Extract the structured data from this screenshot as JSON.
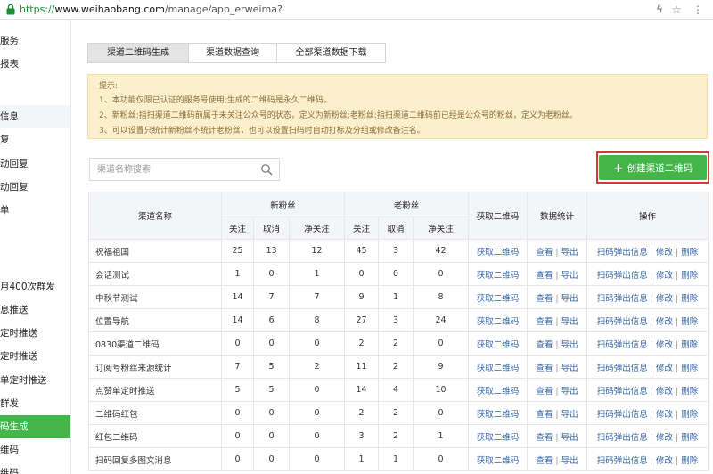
{
  "browser": {
    "url_scheme": "https://",
    "url_domain": "www.weihaobang.com",
    "url_path": "/manage/app_erweima?",
    "star_icon": "☆",
    "bolt_icon": "ϟ",
    "menu_icon": "⋮"
  },
  "sidebar": {
    "items": [
      {
        "label": "服务",
        "state": "normal"
      },
      {
        "label": "报表",
        "state": "normal"
      },
      {
        "label": "信息",
        "state": "grey"
      },
      {
        "label": "复",
        "state": "normal"
      },
      {
        "label": "动回复",
        "state": "normal"
      },
      {
        "label": "动回复",
        "state": "normal"
      },
      {
        "label": "单",
        "state": "normal"
      },
      {
        "label": "月400次群发",
        "state": "normal"
      },
      {
        "label": "息推送",
        "state": "normal"
      },
      {
        "label": "定时推送",
        "state": "normal"
      },
      {
        "label": "定时推送",
        "state": "normal"
      },
      {
        "label": "单定时推送",
        "state": "normal"
      },
      {
        "label": "群发",
        "state": "normal"
      },
      {
        "label": "码生成",
        "state": "active"
      },
      {
        "label": "维码",
        "state": "normal"
      },
      {
        "label": "维码",
        "state": "normal"
      }
    ]
  },
  "tabs": [
    {
      "label": "渠道二维码生成",
      "active": true
    },
    {
      "label": "渠道数据查询",
      "active": false
    },
    {
      "label": "全部渠道数据下载",
      "active": false
    }
  ],
  "notice": {
    "title": "提示:",
    "lines": [
      "1、本功能仅限已认证的服务号使用;生成的二维码是永久二维码。",
      "2、新粉丝:指扫渠道二维码前属于未关注公众号的状态，定义为新粉丝;老粉丝:指扫渠道二维码前已经是公众号的粉丝，定义为老粉丝。",
      "3、可以设置只统计新粉丝不统计老粉丝，也可以设置扫码时自动打标及分组或修改备注名。"
    ]
  },
  "search": {
    "placeholder": "渠道名称搜索",
    "value": ""
  },
  "create_button": {
    "label": "创建渠道二维码"
  },
  "table": {
    "headers": {
      "name": "渠道名称",
      "new_fans": "新粉丝",
      "old_fans": "老粉丝",
      "get_qr": "获取二维码",
      "stats": "数据统计",
      "ops": "操作",
      "follow": "关注",
      "cancel": "取消",
      "net": "净关注"
    },
    "actions": {
      "get_qr": "获取二维码",
      "view": "查看",
      "export": "导出",
      "popup": "扫码弹出信息",
      "edit": "修改",
      "delete": "删除",
      "sep": "|"
    },
    "rows": [
      {
        "name": "祝福祖国",
        "n_follow": "25",
        "n_cancel": "13",
        "n_net": "12",
        "o_follow": "45",
        "o_cancel": "3",
        "o_net": "42"
      },
      {
        "name": "会话测试",
        "n_follow": "1",
        "n_cancel": "0",
        "n_net": "1",
        "o_follow": "0",
        "o_cancel": "0",
        "o_net": "0"
      },
      {
        "name": "中秋节测试",
        "n_follow": "14",
        "n_cancel": "7",
        "n_net": "7",
        "o_follow": "9",
        "o_cancel": "1",
        "o_net": "8"
      },
      {
        "name": "位置导航",
        "n_follow": "14",
        "n_cancel": "6",
        "n_net": "8",
        "o_follow": "27",
        "o_cancel": "3",
        "o_net": "24"
      },
      {
        "name": "0830渠道二维码",
        "n_follow": "0",
        "n_cancel": "0",
        "n_net": "0",
        "o_follow": "2",
        "o_cancel": "2",
        "o_net": "0"
      },
      {
        "name": "订阅号粉丝来源统计",
        "n_follow": "7",
        "n_cancel": "5",
        "n_net": "2",
        "o_follow": "11",
        "o_cancel": "2",
        "o_net": "9"
      },
      {
        "name": "点赞单定时推送",
        "n_follow": "5",
        "n_cancel": "5",
        "n_net": "0",
        "o_follow": "14",
        "o_cancel": "4",
        "o_net": "10"
      },
      {
        "name": "二维码红包",
        "n_follow": "0",
        "n_cancel": "0",
        "n_net": "0",
        "o_follow": "2",
        "o_cancel": "2",
        "o_net": "0"
      },
      {
        "name": "红包二维码",
        "n_follow": "0",
        "n_cancel": "0",
        "n_net": "0",
        "o_follow": "3",
        "o_cancel": "2",
        "o_net": "1"
      },
      {
        "name": "扫码回复多图文消息",
        "n_follow": "0",
        "n_cancel": "0",
        "n_net": "0",
        "o_follow": "1",
        "o_cancel": "1",
        "o_net": "0"
      }
    ]
  },
  "colors": {
    "accent_green": "#44b549",
    "link_blue": "#3565a8",
    "highlight_red": "#d43a3a",
    "notice_bg": "#fcf0cc"
  }
}
